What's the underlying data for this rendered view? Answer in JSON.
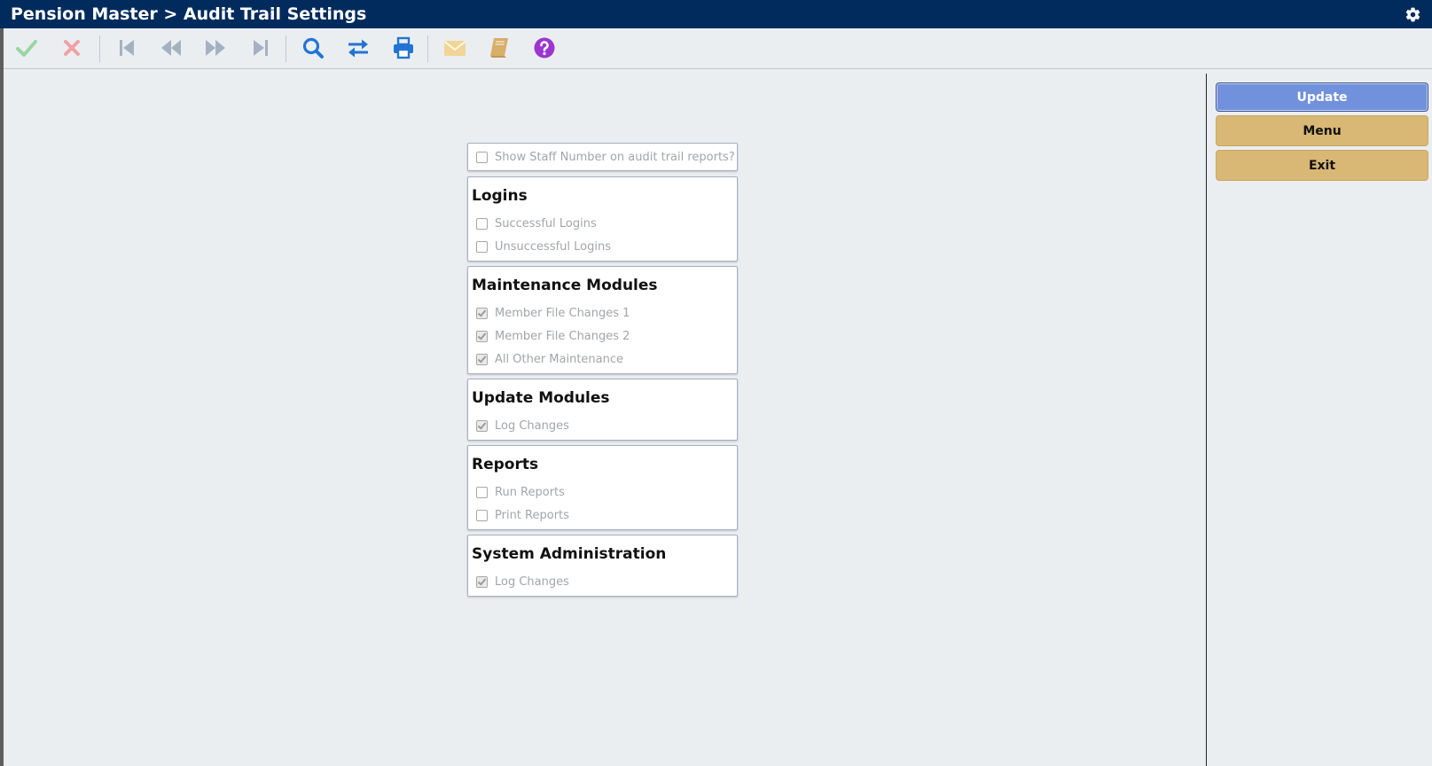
{
  "window": {
    "title": "Pension Master > Audit Trail Settings"
  },
  "toolbar": {
    "icons": [
      "check-icon",
      "cross-icon",
      "first-record-icon",
      "previous-record-icon",
      "next-record-icon",
      "last-record-icon",
      "search-icon",
      "swap-icon",
      "print-icon",
      "mail-icon",
      "notebook-icon",
      "help-icon"
    ]
  },
  "form": {
    "staff_number": {
      "label": "Show Staff Number on audit trail reports?",
      "checked": false
    },
    "logins": {
      "title": "Logins",
      "options": [
        {
          "label": "Successful Logins",
          "checked": false
        },
        {
          "label": "Unsuccessful Logins",
          "checked": false
        }
      ]
    },
    "maintenance": {
      "title": "Maintenance Modules",
      "options": [
        {
          "label": "Member File Changes 1",
          "checked": true
        },
        {
          "label": "Member File Changes 2",
          "checked": true
        },
        {
          "label": "All Other Maintenance",
          "checked": true
        }
      ]
    },
    "update_modules": {
      "title": "Update Modules",
      "options": [
        {
          "label": "Log Changes",
          "checked": true
        }
      ]
    },
    "reports": {
      "title": "Reports",
      "options": [
        {
          "label": "Run Reports",
          "checked": false
        },
        {
          "label": "Print Reports",
          "checked": false
        }
      ]
    },
    "sysadmin": {
      "title": "System Administration",
      "options": [
        {
          "label": "Log Changes",
          "checked": true
        }
      ]
    }
  },
  "actions": {
    "update": "Update",
    "menu": "Menu",
    "exit": "Exit"
  },
  "colors": {
    "titlebar": "#002b5c",
    "update_button": "#7291dc",
    "menu_button": "#d9b775"
  }
}
